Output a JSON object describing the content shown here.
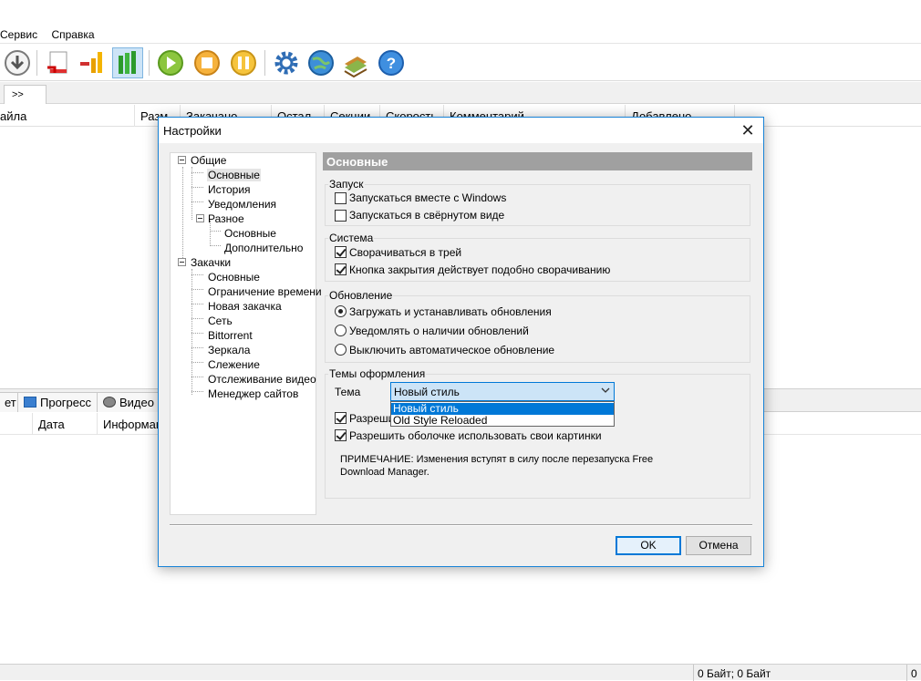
{
  "menubar": {
    "items": [
      "Сервис",
      "Справка"
    ]
  },
  "toolbar": {
    "buttons": [
      {
        "icon": "download-arrow-icon"
      },
      {
        "icon": "low-speed-icon"
      },
      {
        "icon": "medium-speed-icon"
      },
      {
        "icon": "high-speed-icon",
        "active": true
      },
      {
        "icon": "start-icon"
      },
      {
        "icon": "stop-icon"
      },
      {
        "icon": "pause-icon"
      },
      {
        "icon": "settings-gear-icon"
      },
      {
        "icon": "globe-icon"
      },
      {
        "icon": "books-icon"
      },
      {
        "icon": "help-icon"
      }
    ]
  },
  "tabrow": {
    "more_label": ">>"
  },
  "columns": [
    "айла",
    "Разм",
    "Закачано",
    "Остал",
    "Секции",
    "Скорость",
    "Комментарий",
    "Добавлено"
  ],
  "lower_tabs": [
    "ет",
    "Прогресс",
    "Видео"
  ],
  "lower_columns": [
    "Дата",
    "Информац"
  ],
  "statusbar": {
    "traffic": "0 Байт; 0 Байт",
    "last": "0"
  },
  "dialog": {
    "title": "Настройки",
    "close_glyph": "✕",
    "tree": {
      "general": "Общие",
      "general_children": [
        "Основные",
        "История",
        "Уведомления",
        "Разное"
      ],
      "misc_children": [
        "Основные",
        "Дополнительно"
      ],
      "downloads": "Закачки",
      "downloads_children": [
        "Основные",
        "Ограничение времени",
        "Новая закачка",
        "Сеть",
        "Bittorrent",
        "Зеркала",
        "Слежение",
        "Отслеживание видео",
        "Менеджер сайтов"
      ]
    },
    "page_heading": "Основные",
    "startup": {
      "label": "Запуск",
      "options": [
        {
          "label": "Запускаться вместе с Windows",
          "checked": false
        },
        {
          "label": "Запускаться в свёрнутом виде",
          "checked": false
        }
      ]
    },
    "system": {
      "label": "Система",
      "options": [
        {
          "label": "Сворачиваться в трей",
          "checked": true
        },
        {
          "label": "Кнопка закрытия действует подобно сворачиванию",
          "checked": true
        }
      ]
    },
    "update": {
      "label": "Обновление",
      "options": [
        {
          "label": "Загружать и устанавливать обновления",
          "selected": true
        },
        {
          "label": "Уведомлять о наличии обновлений",
          "selected": false
        },
        {
          "label": "Выключить автоматическое обновление",
          "selected": false
        }
      ]
    },
    "themes": {
      "label": "Темы оформления",
      "theme_label": "Тема",
      "theme_value": "Новый стиль",
      "dropdown_options": [
        "Новый стиль",
        "Old Style Reloaded"
      ],
      "allow1_partial": "Разрешит",
      "allow1_checked": true,
      "allow2": "Разрешить оболочке использовать свои картинки",
      "allow2_checked": true,
      "note": "ПРИМЕЧАНИЕ: Изменения вступят в силу после перезапуска Free Download Manager."
    },
    "ok_label": "OK",
    "cancel_label": "Отмена"
  },
  "colors": {
    "accent": "#0078d7",
    "heading_bg": "#a0a0a0",
    "dialog_bg": "#f0f0f0"
  }
}
